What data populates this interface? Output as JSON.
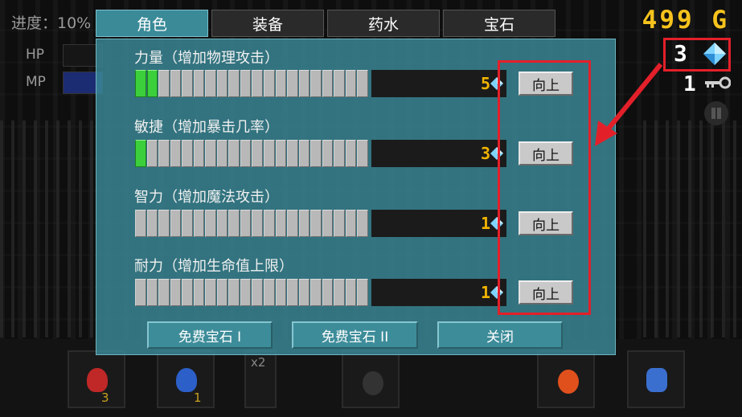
{
  "hud": {
    "progress": "进度：10%",
    "hp_label": "HP",
    "mp_label": "MP",
    "gold": "499 G",
    "gems": "3",
    "keys": "1"
  },
  "tabs": [
    {
      "label": "角色",
      "active": true
    },
    {
      "label": "装备",
      "active": false
    },
    {
      "label": "药水",
      "active": false
    },
    {
      "label": "宝石",
      "active": false
    }
  ],
  "stats": [
    {
      "label": "力量（增加物理攻击）",
      "value": "5",
      "level": 2,
      "max_level": 20,
      "button": "向上"
    },
    {
      "label": "敏捷（增加暴击几率）",
      "value": "3",
      "level": 1,
      "max_level": 20,
      "button": "向上"
    },
    {
      "label": "智力（增加魔法攻击）",
      "value": "1",
      "level": 0,
      "max_level": 20,
      "button": "向上"
    },
    {
      "label": "耐力（增加生命值上限）",
      "value": "1",
      "level": 0,
      "max_level": 20,
      "button": "向上"
    }
  ],
  "footer": {
    "free_gem_1": "免费宝石 I",
    "free_gem_2": "免费宝石 II",
    "close": "关闭"
  },
  "hotbar": {
    "red_potion_count": "3",
    "blue_potion_count": "1",
    "x2_label": "x2"
  },
  "colors": {
    "dialog": "#3a8a98",
    "gold": "#f6c31d",
    "value": "#f2b400",
    "highlight": "#e3202a",
    "meter_on": "#3ccf3c",
    "meter_off": "#b8b8b8"
  }
}
